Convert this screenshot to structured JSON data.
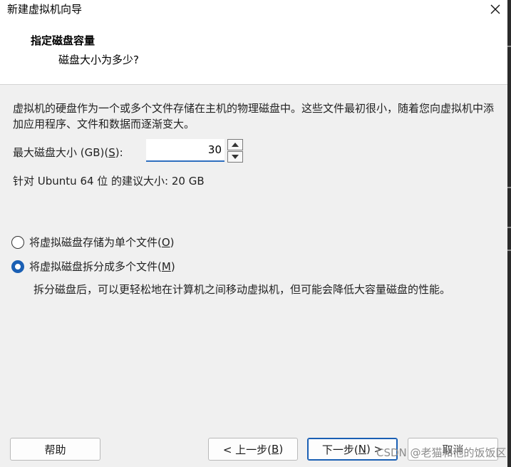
{
  "window": {
    "title": "新建虚拟机向导",
    "close_icon": "close-icon"
  },
  "header": {
    "title": "指定磁盘容量",
    "subtitle": "磁盘大小为多少?"
  },
  "body": {
    "description": "虚拟机的硬盘作为一个或多个文件存储在主机的物理磁盘中。这些文件最初很小，随着您向虚拟机中添加应用程序、文件和数据而逐渐变大。",
    "size_label_prefix": "最大磁盘大小 (GB)(",
    "size_label_key": "S",
    "size_label_suffix": "):",
    "size_value": "30",
    "recommendation": "针对 Ubuntu 64 位 的建议大小: 20 GB"
  },
  "options": {
    "single_file": {
      "prefix": "将虚拟磁盘存储为单个文件(",
      "key": "O",
      "suffix": ")",
      "checked": false
    },
    "split_files": {
      "prefix": "将虚拟磁盘拆分成多个文件(",
      "key": "M",
      "suffix": ")",
      "checked": true
    },
    "split_description": "拆分磁盘后，可以更轻松地在计算机之间移动虚拟机，但可能会降低大容量磁盘的性能。"
  },
  "buttons": {
    "help": "帮助",
    "back_prefix": "< 上一步(",
    "back_key": "B",
    "back_suffix": ")",
    "next_prefix": "下一步(",
    "next_key": "N",
    "next_suffix": ") >",
    "cancel": "取消"
  },
  "watermark": "CSDN @老猫和他的饭饭区",
  "colors": {
    "accent": "#1a5fb4",
    "window_bg": "#f0f0f0",
    "header_bg": "#ffffff"
  }
}
